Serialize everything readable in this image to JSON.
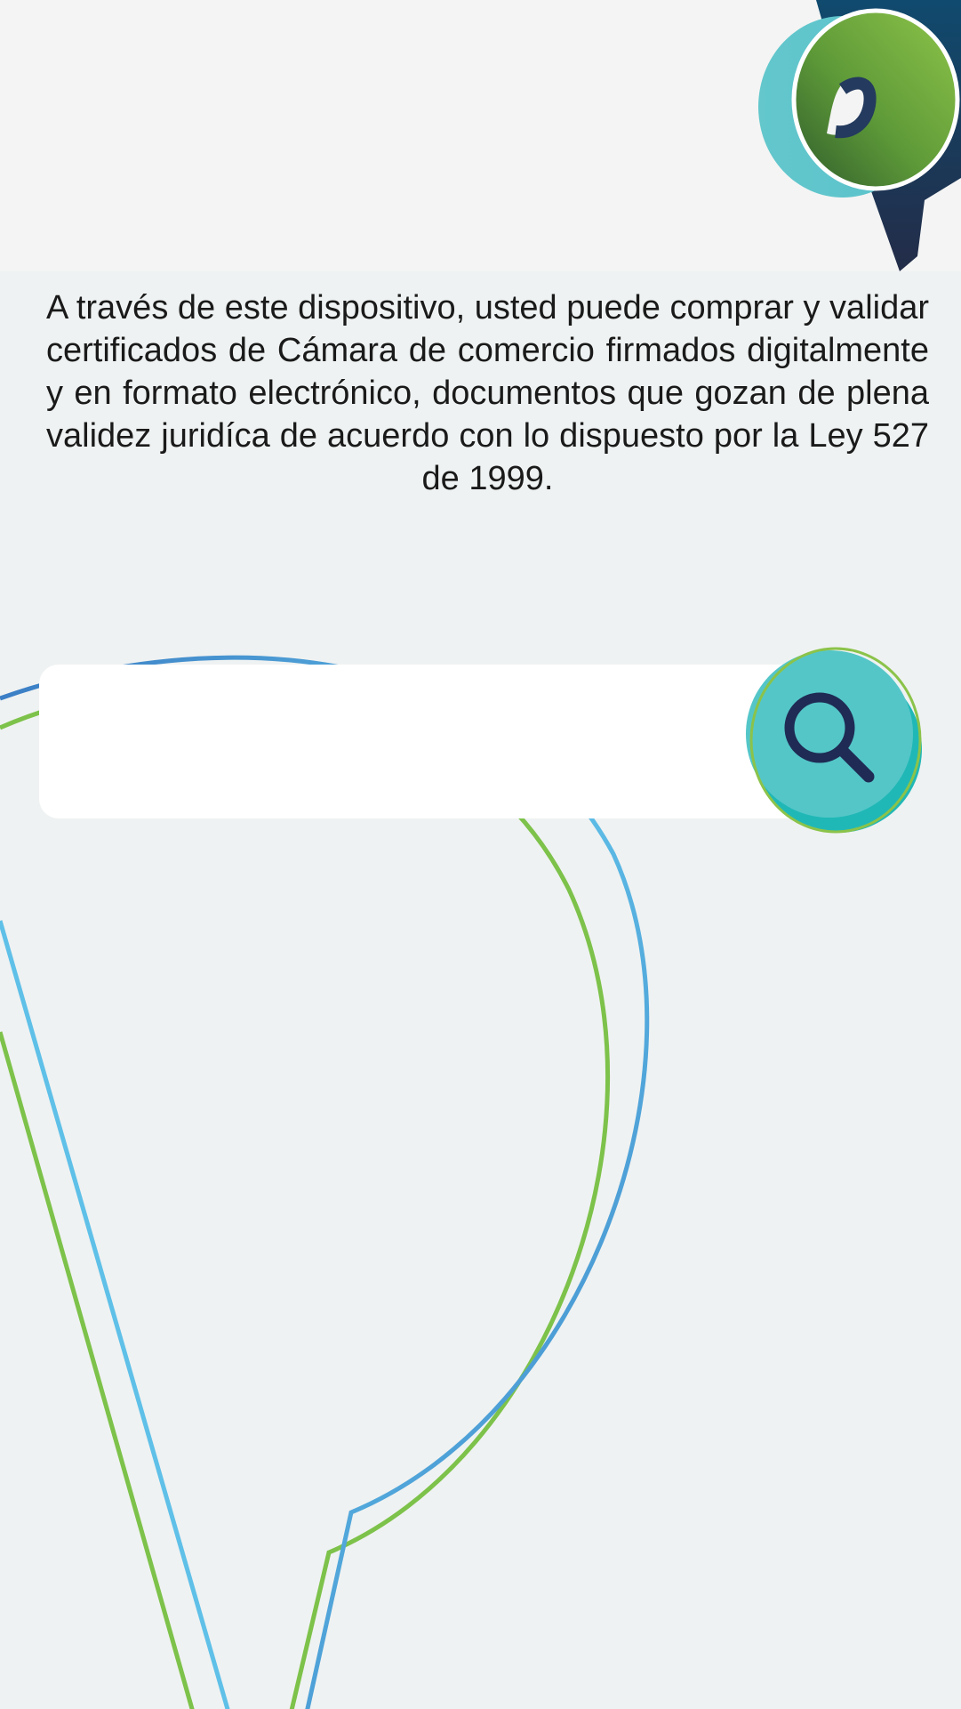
{
  "description": "A través de este dispositivo, usted puede comprar y validar certificados de Cámara de comercio firmados digitalmente y en formato electrónico, documentos que gozan de plena validez juridíca de acuerdo con lo dispuesto por la Ley 527 de 1999.",
  "search": {
    "value": "",
    "placeholder": "",
    "button_icon": "search-icon"
  },
  "logo": {
    "icon": "brand-logo"
  },
  "colors": {
    "background": "#eff2f2",
    "header": "#f4f4f4",
    "navy": "#1f2b54",
    "teal": "#54c6c8",
    "green": "#8bc34a",
    "blue": "#4a9bd8"
  }
}
